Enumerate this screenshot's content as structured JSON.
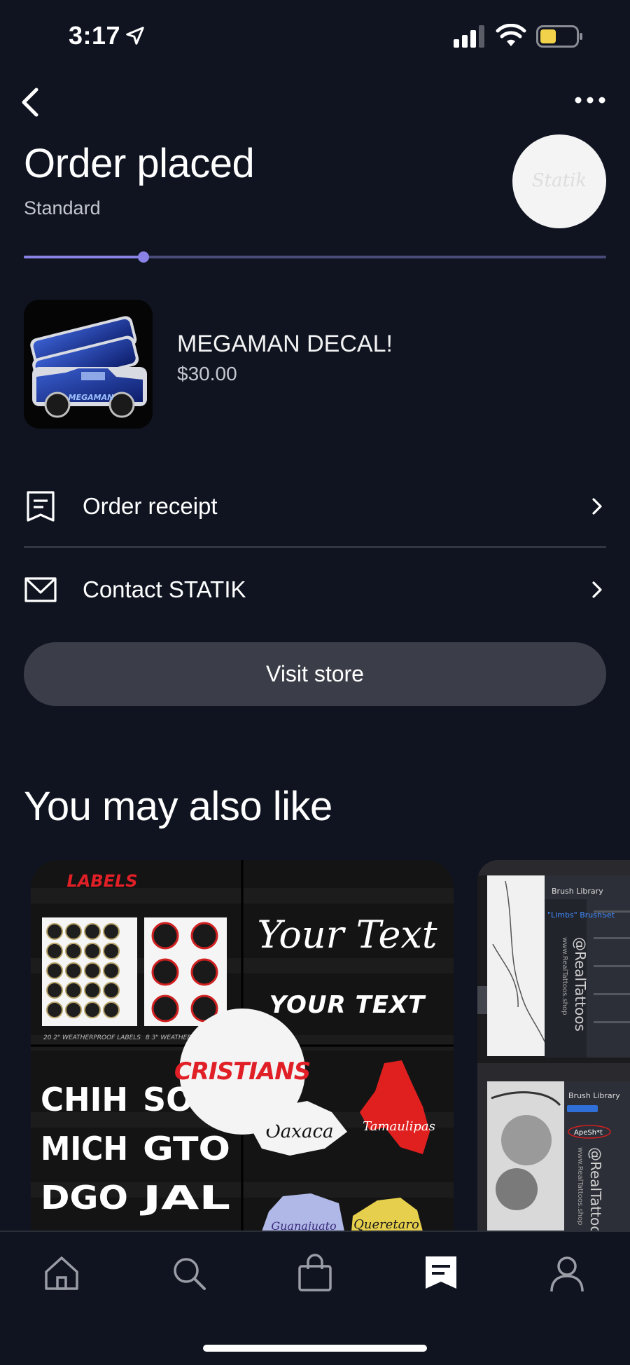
{
  "status_bar": {
    "time": "3:17"
  },
  "header": {
    "title": "Order placed",
    "subtitle": "Standard",
    "store_avatar_text": "Statik"
  },
  "progress": {
    "value": 0.206
  },
  "product": {
    "name": "MEGAMAN DECAL!",
    "price": "$30.00",
    "image_icon": "truck-decal-image",
    "decal_text": "MEGAMAN"
  },
  "actions": {
    "receipt_label": "Order receipt",
    "contact_label": "Contact STATIK",
    "visit_store_label": "Visit store"
  },
  "recommendations": {
    "section_title": "You may also like",
    "card1": {
      "labels_heading": "LABELS",
      "labels_caption_1": "20 2\" WEATHERPROOF LABELS",
      "labels_caption_2": "8 3\" WEATHERPROOF",
      "your_text_script": "Your Text",
      "your_text_block": "YOUR TEXT",
      "states": [
        "CHIH",
        "SO",
        "MICH",
        "GTO",
        "DGO",
        "JAL"
      ],
      "region_1": "Oaxaca",
      "region_2": "Tamaulipas",
      "region_3": "Guanajuato",
      "region_4": "Queretaro",
      "seller": "CRISTIANS"
    },
    "card2": {
      "panel_title": "Brush Library",
      "panel_item": "\"Limbs\" BrushSet",
      "watermark": "@RealTattoos",
      "site": "www.RealTattoos.shop",
      "panel_title_2": "Brush Library",
      "panel_item_2": "ApeSh*t"
    }
  },
  "tabs": [
    "home",
    "search",
    "shop",
    "orders",
    "profile"
  ],
  "colors": {
    "background": "#0f1420",
    "accent": "#8a82e6",
    "button": "#3b3e48"
  }
}
